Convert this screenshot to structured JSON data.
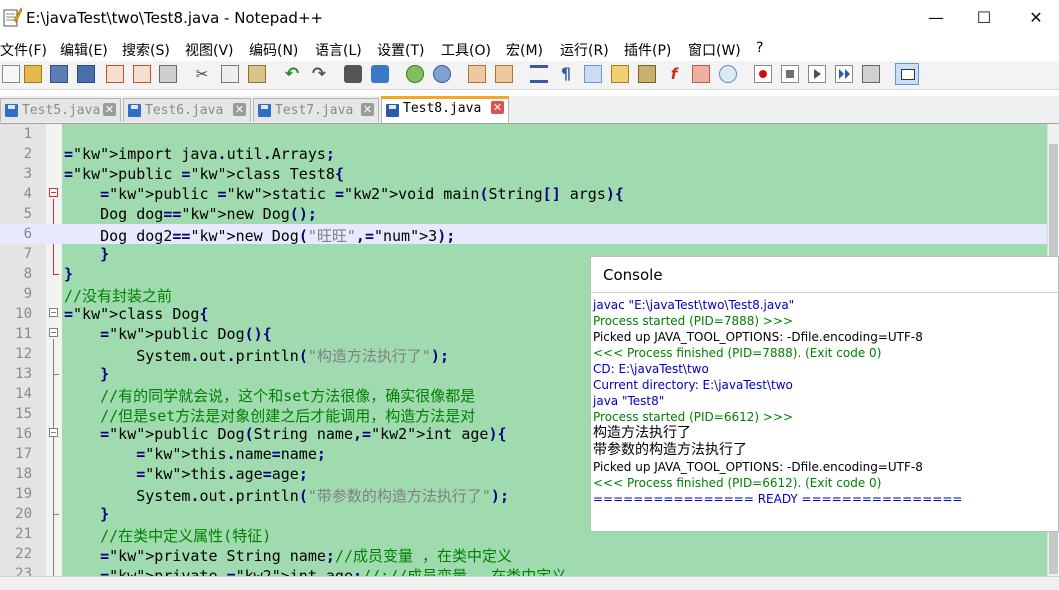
{
  "window": {
    "title": "E:\\javaTest\\two\\Test8.java - Notepad++",
    "minimize": "—",
    "maximize": "☐",
    "close": "✕"
  },
  "menu": [
    "文件(F)",
    "编辑(E)",
    "搜索(S)",
    "视图(V)",
    "编码(N)",
    "语言(L)",
    "设置(T)",
    "工具(O)",
    "宏(M)",
    "运行(R)",
    "插件(P)",
    "窗口(W)",
    "?"
  ],
  "toolbar_icons": [
    "new-file-icon",
    "open-file-icon",
    "save-icon",
    "save-all-icon",
    "close-icon",
    "close-all-icon",
    "print-icon",
    "cut-icon",
    "copy-icon",
    "paste-icon",
    "undo-icon",
    "redo-icon",
    "find-icon",
    "replace-icon",
    "zoom-in-icon",
    "zoom-out-icon",
    "sync-vertical-icon",
    "sync-horizontal-icon",
    "word-wrap-icon",
    "show-all-chars-icon",
    "indent-guide-icon",
    "user-lang-icon",
    "doc-map-icon",
    "function-list-icon",
    "folder-workspace-icon",
    "monitor-icon",
    "record-macro-icon",
    "stop-macro-icon",
    "play-macro-icon",
    "run-macro-multiple-icon",
    "save-macro-icon",
    "console-icon"
  ],
  "tabs": [
    {
      "label": "Test5.java",
      "active": false
    },
    {
      "label": "Test6.java",
      "active": false
    },
    {
      "label": "Test7.java",
      "active": false
    },
    {
      "label": "Test8.java",
      "active": true
    }
  ],
  "editor": {
    "current_line": 6,
    "lines": [
      {
        "n": "1",
        "code": ""
      },
      {
        "n": "2",
        "code": "import java.util.Arrays;"
      },
      {
        "n": "3",
        "code": "public class Test8{"
      },
      {
        "n": "4",
        "code": "    public static void main(String[] args){"
      },
      {
        "n": "5",
        "code": "    Dog dog=new Dog();"
      },
      {
        "n": "6",
        "code": "    Dog dog2=new Dog(\"旺旺\",3);"
      },
      {
        "n": "7",
        "code": "    }"
      },
      {
        "n": "8",
        "code": "}"
      },
      {
        "n": "9",
        "code": "//没有封装之前"
      },
      {
        "n": "10",
        "code": "class Dog{"
      },
      {
        "n": "11",
        "code": "    public Dog(){"
      },
      {
        "n": "12",
        "code": "        System.out.println(\"构造方法执行了\");"
      },
      {
        "n": "13",
        "code": "    }"
      },
      {
        "n": "14",
        "code": "    //有的同学就会说，这个和set方法很像，确实很像都是"
      },
      {
        "n": "15",
        "code": "    //但是set方法是对象创建之后才能调用，构造方法是对"
      },
      {
        "n": "16",
        "code": "    public Dog(String name,int age){"
      },
      {
        "n": "17",
        "code": "        this.name=name;"
      },
      {
        "n": "18",
        "code": "        this.age=age;"
      },
      {
        "n": "19",
        "code": "        System.out.println(\"带参数的构造方法执行了\");"
      },
      {
        "n": "20",
        "code": "    }"
      },
      {
        "n": "21",
        "code": "    //在类中定义属性(特征)"
      },
      {
        "n": "22",
        "code": "    private String name;//成员变量 ，在类中定义"
      },
      {
        "n": "23",
        "code": "    private int age;//://成员变量 ，在类中定义"
      }
    ]
  },
  "console": {
    "title": "Console",
    "lines": [
      {
        "text": "javac \"E:\\javaTest\\two\\Test8.java\"",
        "color": "b"
      },
      {
        "text": "Process started (PID=7888) >>>",
        "color": "g"
      },
      {
        "text": "Picked up JAVA_TOOL_OPTIONS: -Dfile.encoding=UTF-8",
        "color": ""
      },
      {
        "text": "<<< Process finished (PID=7888). (Exit code 0)",
        "color": "g"
      },
      {
        "text": "CD: E:\\javaTest\\two",
        "color": "b"
      },
      {
        "text": "Current directory: E:\\javaTest\\two",
        "color": "b"
      },
      {
        "text": "java \"Test8\"",
        "color": "b"
      },
      {
        "text": "Process started (PID=6612) >>>",
        "color": "g"
      },
      {
        "text": "构造方法执行了",
        "color": "big"
      },
      {
        "text": "带参数的构造方法执行了",
        "color": "big"
      },
      {
        "text": "Picked up JAVA_TOOL_OPTIONS: -Dfile.encoding=UTF-8",
        "color": ""
      },
      {
        "text": "<<< Process finished (PID=6612). (Exit code 0)",
        "color": "g"
      },
      {
        "text": "================ READY ================",
        "color": "b"
      }
    ]
  }
}
